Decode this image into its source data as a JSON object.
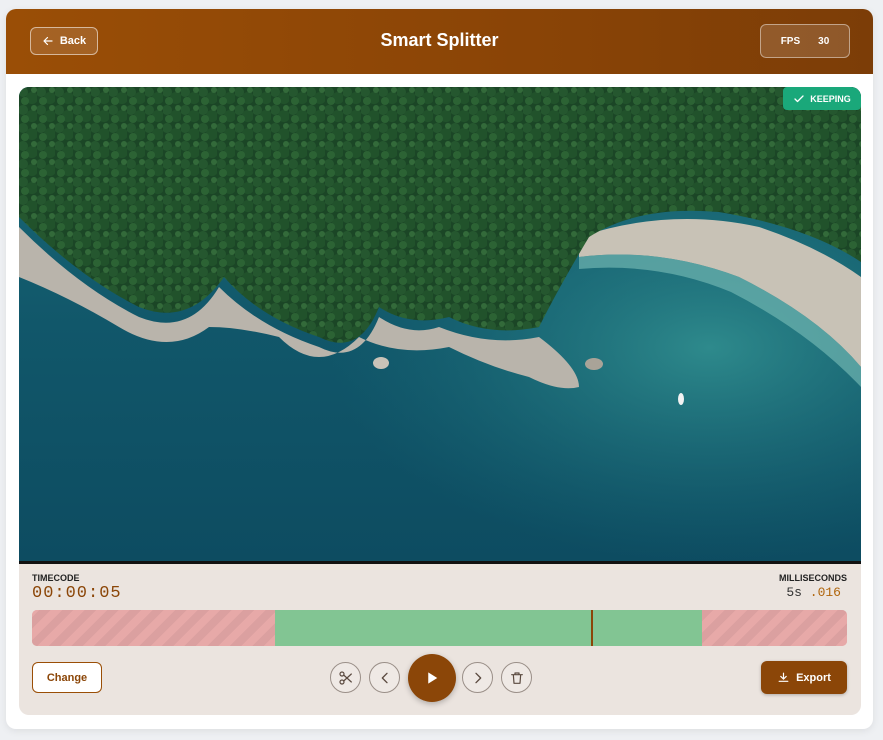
{
  "header": {
    "back_label": "Back",
    "title": "Smart Splitter",
    "fps_label": "FPS",
    "fps_value": "30"
  },
  "video": {
    "badge_label": "KEEPING",
    "badge_color": "#1aa87a",
    "scene": "aerial coastline with forest, rocky cliffs and turquoise sea"
  },
  "readout": {
    "timecode_label": "TIMECODE",
    "timecode_value": "00:00:05",
    "ms_label": "MILLISECONDS",
    "ms_seconds": "5s",
    "ms_fraction": ".016"
  },
  "timeline": {
    "segments": [
      {
        "state": "cut",
        "start": 0.0,
        "end": 0.298
      },
      {
        "state": "keep",
        "start": 0.298,
        "end": 0.822
      },
      {
        "state": "cut",
        "start": 0.822,
        "end": 1.0
      }
    ],
    "playhead": 0.686,
    "keep_color": "#82c593",
    "cut_color": "#e7a9a8"
  },
  "controls": {
    "change_label": "Change",
    "export_label": "Export",
    "icons": [
      "scissors-icon",
      "chevron-left-icon",
      "play-icon",
      "chevron-right-icon",
      "trash-icon"
    ]
  },
  "colors": {
    "brand": "#8b4608",
    "header_gradient_start": "#9a4e06"
  }
}
